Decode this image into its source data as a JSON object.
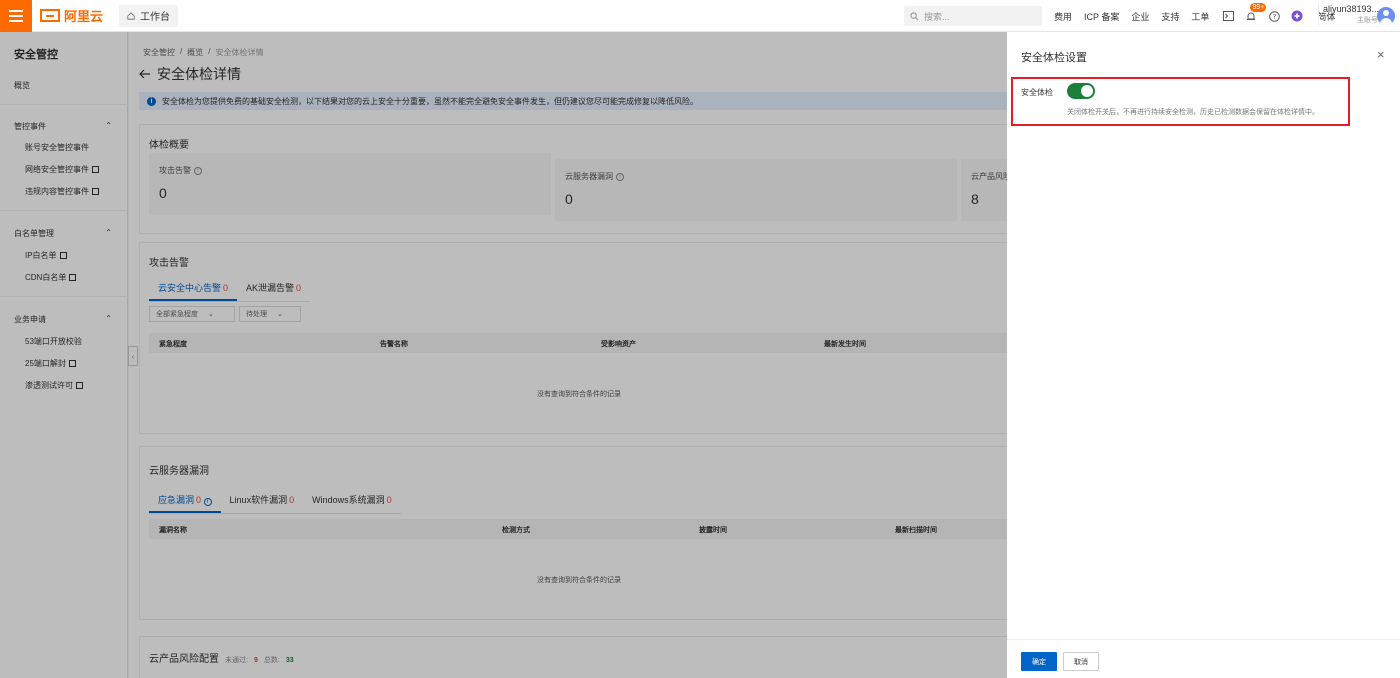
{
  "topbar": {
    "brand": "阿里云",
    "workbench": "工作台",
    "search_placeholder": "搜索...",
    "nav": [
      "费用",
      "ICP 备案",
      "企业",
      "支持",
      "工单"
    ],
    "notification_badge": "99+",
    "language": "简体",
    "username": "aliyun38193...",
    "account_type": "主账号"
  },
  "sidebar": {
    "title": "安全管控",
    "overview": "概览",
    "groups": [
      {
        "label": "管控事件",
        "items": [
          "账号安全管控事件",
          "网络安全管控事件",
          "违规内容管控事件"
        ]
      },
      {
        "label": "白名单管理",
        "items": [
          "IP白名单",
          "CDN白名单"
        ]
      },
      {
        "label": "业务申请",
        "items": [
          "53端口开放校验",
          "25端口解封",
          "渗透测试许可"
        ]
      }
    ]
  },
  "main": {
    "breadcrumb": [
      "安全管控",
      "概览",
      "安全体检详情"
    ],
    "title": "安全体检详情",
    "info": "安全体检为您提供免费的基础安全检测，以下结果对您的云上安全十分重要，虽然不能完全避免安全事件发生，但仍建议您尽可能完成修复以降低风险。",
    "summary": {
      "title": "体检概要",
      "stats": [
        {
          "label": "攻击告警",
          "value": "0"
        },
        {
          "label": "云服务器漏洞",
          "value": "0"
        },
        {
          "label": "云产品风险配",
          "value": "8"
        }
      ]
    },
    "attack": {
      "title": "攻击告警",
      "tabs": [
        {
          "label": "云安全中心告警",
          "count": "0"
        },
        {
          "label": "AK泄漏告警",
          "count": "0"
        }
      ],
      "filters": [
        "全部紧急程度",
        "待处理"
      ],
      "columns": [
        "紧急程度",
        "告警名称",
        "受影响资产",
        "最新发生时间"
      ],
      "empty": "没有查询到符合条件的记录"
    },
    "vuln": {
      "title": "云服务器漏洞",
      "tabs": [
        {
          "label": "应急漏洞",
          "count": "0"
        },
        {
          "label": "Linux软件漏洞",
          "count": "0"
        },
        {
          "label": "Windows系统漏洞",
          "count": "0"
        }
      ],
      "columns": [
        "漏洞名称",
        "检测方式",
        "披露时间",
        "最新扫描时间"
      ],
      "empty": "没有查询到符合条件的记录"
    },
    "risk": {
      "title": "云产品风险配置",
      "failed_label": "未通过:",
      "failed": "9",
      "total_label": "总数:",
      "total": "33"
    }
  },
  "drawer": {
    "title": "安全体检设置",
    "toggle_label": "安全体检",
    "toggle_on": true,
    "description": "关闭体检开关后，不再进行持续安全检测，历史已检测数据会保留在体检详情中。",
    "ok": "确定",
    "cancel": "取消"
  },
  "colors": {
    "brand": "#ff6a00",
    "primary": "#0064c8",
    "toggle_on": "#1a7f3b",
    "highlight": "#e51c23"
  }
}
